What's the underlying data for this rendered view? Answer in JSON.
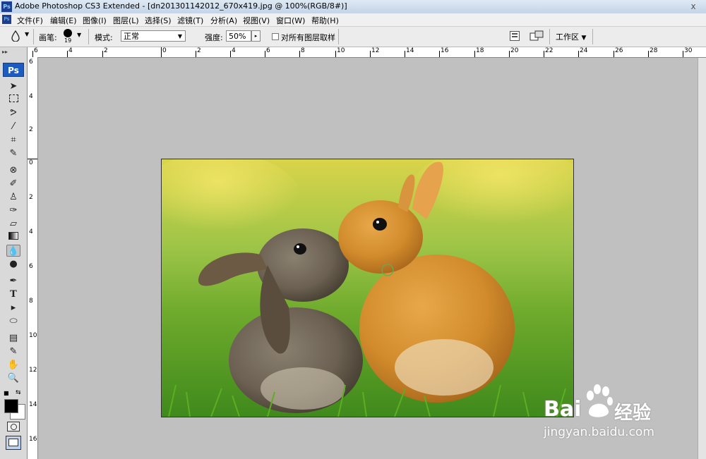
{
  "window": {
    "title": "Adobe Photoshop CS3 Extended - [dn201301142012_670x419.jpg @ 100%(RGB/8#)]",
    "ps_logo": "Ps",
    "close_glyph": "x"
  },
  "menu": [
    "文件(F)",
    "编辑(E)",
    "图像(I)",
    "图层(L)",
    "选择(S)",
    "滤镜(T)",
    "分析(A)",
    "视图(V)",
    "窗口(W)",
    "帮助(H)"
  ],
  "options": {
    "brush_label": "画笔:",
    "brush_size": "19",
    "mode_label": "模式:",
    "mode_value": "正常",
    "strength_label": "强度:",
    "strength_value": "50%",
    "sample_all_label": "对所有图层取样",
    "sample_all_checked": false,
    "workspace_label": "工作区"
  },
  "toolbox": {
    "logo": "Ps",
    "active_tool": "blur-tool",
    "foreground_color": "#000000",
    "background_color": "#ffffff"
  },
  "ruler_top_labels": [
    "6",
    "4",
    "2",
    "0",
    "2",
    "4",
    "6",
    "8",
    "10",
    "12",
    "14",
    "16",
    "18",
    "20",
    "22",
    "24",
    "26",
    "28",
    "30"
  ],
  "ruler_left_labels": [
    "6",
    "4",
    "2",
    "0",
    "2",
    "4",
    "6",
    "8",
    "10",
    "12",
    "14",
    "16"
  ],
  "watermark": {
    "brand": "Bai",
    "brand_suffix": "经验",
    "url": "jingyan.baidu.com"
  }
}
